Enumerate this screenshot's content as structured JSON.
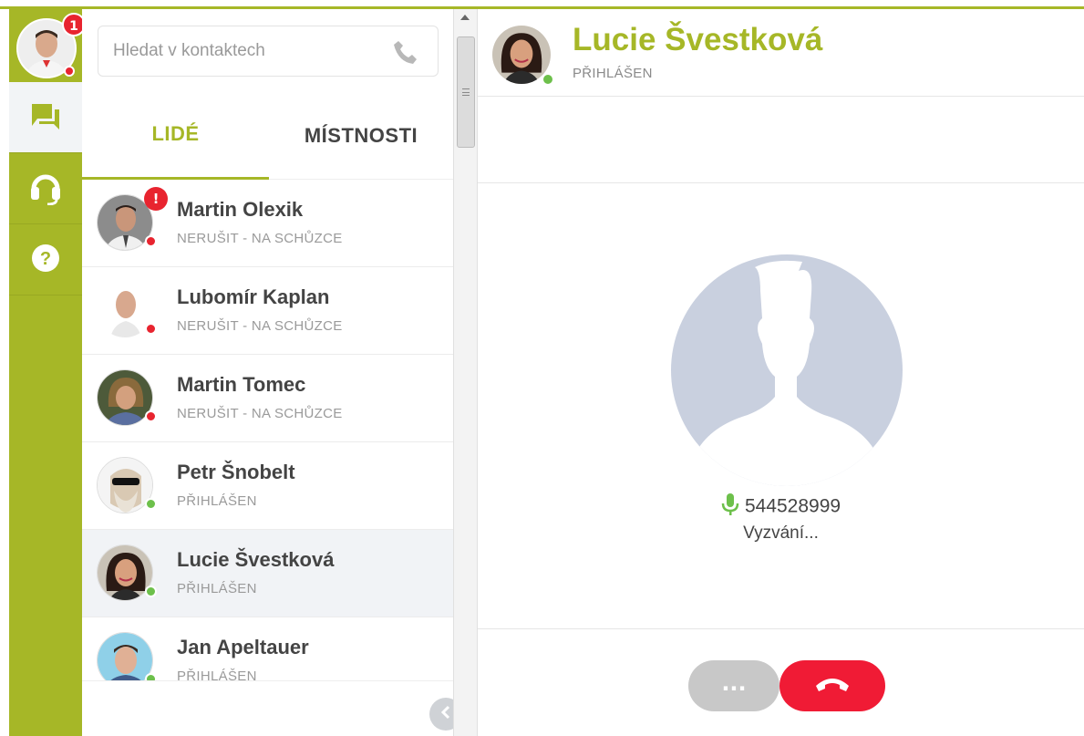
{
  "rail": {
    "me_badge": "1",
    "items": [
      "chat-icon",
      "headset-icon",
      "help-icon"
    ],
    "accent": "#a6b727"
  },
  "search": {
    "placeholder": "Hledat v kontaktech"
  },
  "tabs": {
    "people": "LIDÉ",
    "rooms": "MÍSTNOSTI"
  },
  "contacts": [
    {
      "name": "Martin Olexik",
      "status": "NERUŠIT - NA SCHŮZCE",
      "presence": "busy",
      "alert": "!"
    },
    {
      "name": "Lubomír Kaplan",
      "status": "NERUŠIT - NA SCHŮZCE",
      "presence": "busy"
    },
    {
      "name": "Martin Tomec",
      "status": "NERUŠIT - NA SCHŮZCE",
      "presence": "busy"
    },
    {
      "name": "Petr Šnobelt",
      "status": "PŘIHLÁŠEN",
      "presence": "online"
    },
    {
      "name": "Lucie Švestková",
      "status": "PŘIHLÁŠEN",
      "presence": "online",
      "selected": true
    },
    {
      "name": "Jan Apeltauer",
      "status": "PŘIHLÁŠEN",
      "presence": "online"
    }
  ],
  "conversation": {
    "name": "Lucie Švestková",
    "status": "PŘIHLÁŠEN",
    "call_number": "544528999",
    "call_state": "Vyzvání...",
    "more_label": "..."
  },
  "colors": {
    "busy": "#e8242f",
    "online": "#6dc04b",
    "hangup": "#f01b35"
  }
}
